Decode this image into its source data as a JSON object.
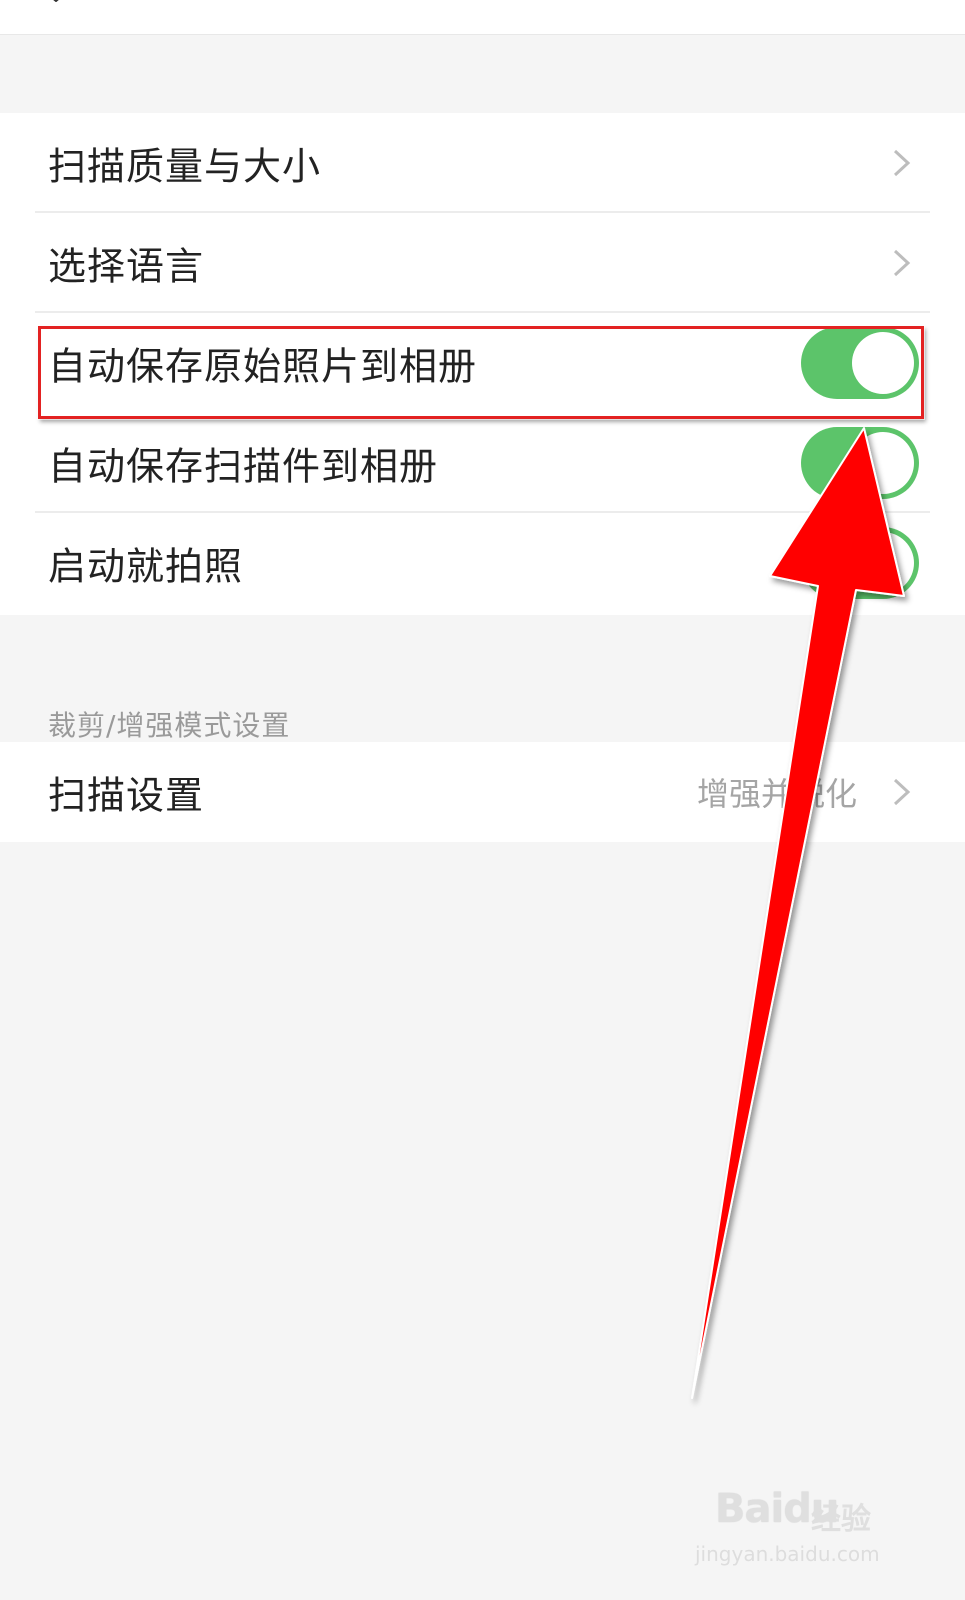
{
  "settings_group_1": {
    "items": [
      {
        "label": "扫描质量与大小",
        "control": "chevron-right-icon"
      },
      {
        "label": "选择语言",
        "control": "chevron-right-icon"
      },
      {
        "label": "自动保存原始照片到相册",
        "control": "toggle",
        "on": true
      },
      {
        "label": "自动保存扫描件到相册",
        "control": "toggle",
        "on": true
      },
      {
        "label": "启动就拍照",
        "control": "toggle",
        "on": true
      }
    ]
  },
  "section_crop_enhance": {
    "header": "裁剪/增强模式设置",
    "items": [
      {
        "label": "扫描设置",
        "value": "增强并锐化",
        "control": "chevron-right-icon"
      }
    ]
  },
  "annotations": {
    "highlight_color": "#e32222",
    "arrow_color": "#ff0000"
  },
  "watermark": {
    "brand": "Baidu",
    "product": "经验",
    "url": "jingyan.baidu.com"
  },
  "colors": {
    "toggle_on": "#5cc46a",
    "background": "#f5f5f5"
  }
}
